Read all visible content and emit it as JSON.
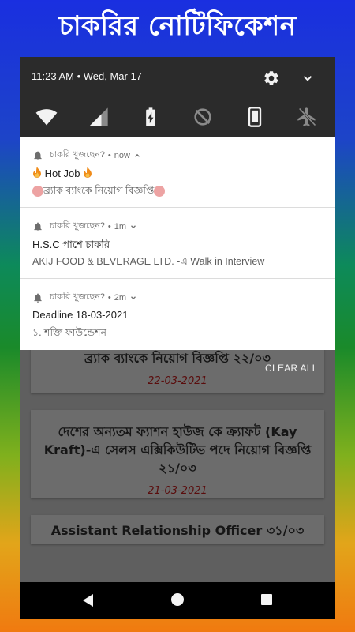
{
  "promo": {
    "title": "চাকরির নোটিফিকেশন"
  },
  "status": {
    "time_date": "11:23 AM • Wed, Mar 17"
  },
  "quick_settings": [
    "wifi-icon",
    "signal-icon",
    "battery-charging-icon",
    "data-saver-icon",
    "phone-portrait-icon",
    "airplane-mode-icon"
  ],
  "notifications": [
    {
      "app": "চাকরি খুজছেন?",
      "time": "now",
      "title": "Hot Job",
      "body": "ব্র্যাক ব্যাংকে নিয়োগ বিজ্ঞপ্তি"
    },
    {
      "app": "চাকরি খুজছেন?",
      "time": "1m",
      "title": "H.S.C পাশে চাকরি",
      "body": "AKIJ FOOD & BEVERAGE LTD. -এ Walk in Interview"
    },
    {
      "app": "চাকরি খুজছেন?",
      "time": "2m",
      "title": "Deadline  18-03-2021",
      "body": "১. শক্তি ফাউন্ডেশন"
    }
  ],
  "shade_actions": {
    "clear_all": "CLEAR ALL"
  },
  "job_list": [
    {
      "title": "ব্র্যাক ব্যাংকে নিয়োগ বিজ্ঞপ্তি ২২/০৩",
      "date": "22-03-2021"
    },
    {
      "title": "দেশের অন্যতম ফ্যাশন হাউজ কে ক্র্যাফট (Kay Kraft)-এ সেলস এক্সিকিউটিভ পদে নিয়োগ বিজ্ঞপ্তি ২১/০৩",
      "date": "21-03-2021"
    },
    {
      "title": "Assistant Relationship Officer ৩১/০৩",
      "date": ""
    }
  ],
  "colors": {
    "shade": "#2b2b2b",
    "notification_bg": "#ffffff",
    "date_text": "#5a0d0d"
  }
}
